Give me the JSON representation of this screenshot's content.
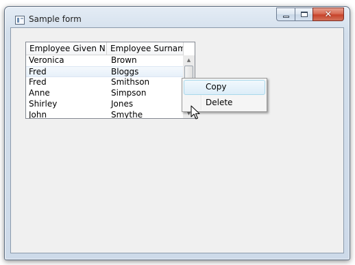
{
  "window": {
    "title": "Sample form",
    "icon": "form-icon",
    "caption_buttons": {
      "minimize": "minimize-icon",
      "maximize": "maximize-icon",
      "close": "close-icon",
      "close_glyph": "✕"
    }
  },
  "grid": {
    "columns": [
      "Employee Given N...",
      "Employee Surname"
    ],
    "rows": [
      {
        "given": "Veronica",
        "surname": "Brown"
      },
      {
        "given": "Fred",
        "surname": "Bloggs",
        "selected": true
      },
      {
        "given": "Fred",
        "surname": "Smithson"
      },
      {
        "given": "Anne",
        "surname": "Simpson"
      },
      {
        "given": "Shirley",
        "surname": "Jones"
      },
      {
        "given": "John",
        "surname": "Smythe"
      }
    ],
    "scrollbar": {
      "up_glyph": "▲",
      "down_glyph": "▼"
    }
  },
  "context_menu": {
    "items": [
      {
        "label": "Copy",
        "highlighted": true
      },
      {
        "label": "Delete"
      }
    ]
  },
  "colors": {
    "selection": "#e7f0fa",
    "menu_highlight": "#dcedf8",
    "close_button": "#c7432a"
  }
}
